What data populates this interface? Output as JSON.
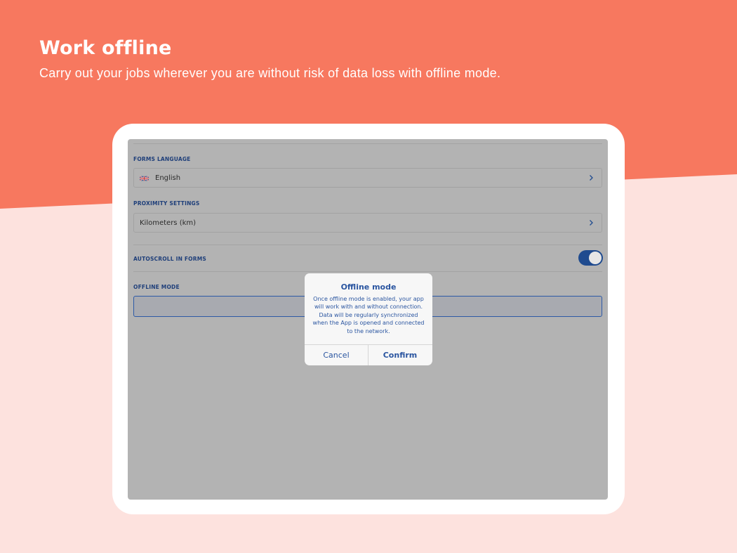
{
  "colors": {
    "banner": "#f7785f",
    "background": "#fde2de",
    "accent": "#1f4b8f"
  },
  "header": {
    "title": "Work offline",
    "subtitle": "Carry out your jobs wherever you are without risk of data loss with offline mode."
  },
  "settings": {
    "forms_language": {
      "label": "FORMS LANGUAGE",
      "value": "English",
      "flag_icon": "uk-flag-icon"
    },
    "proximity": {
      "label": "PROXIMITY SETTINGS",
      "value": "Kilometers (km)"
    },
    "autoscroll": {
      "label": "AUTOSCROLL IN FORMS",
      "enabled": true
    },
    "offline_mode": {
      "label": "OFFLINE MODE"
    }
  },
  "dialog": {
    "title": "Offline mode",
    "message": "Once offline mode is enabled, your app will work with and without connection. Data will be regularly synchronized when the App is opened and connected to the network.",
    "cancel_label": "Cancel",
    "confirm_label": "Confirm"
  }
}
